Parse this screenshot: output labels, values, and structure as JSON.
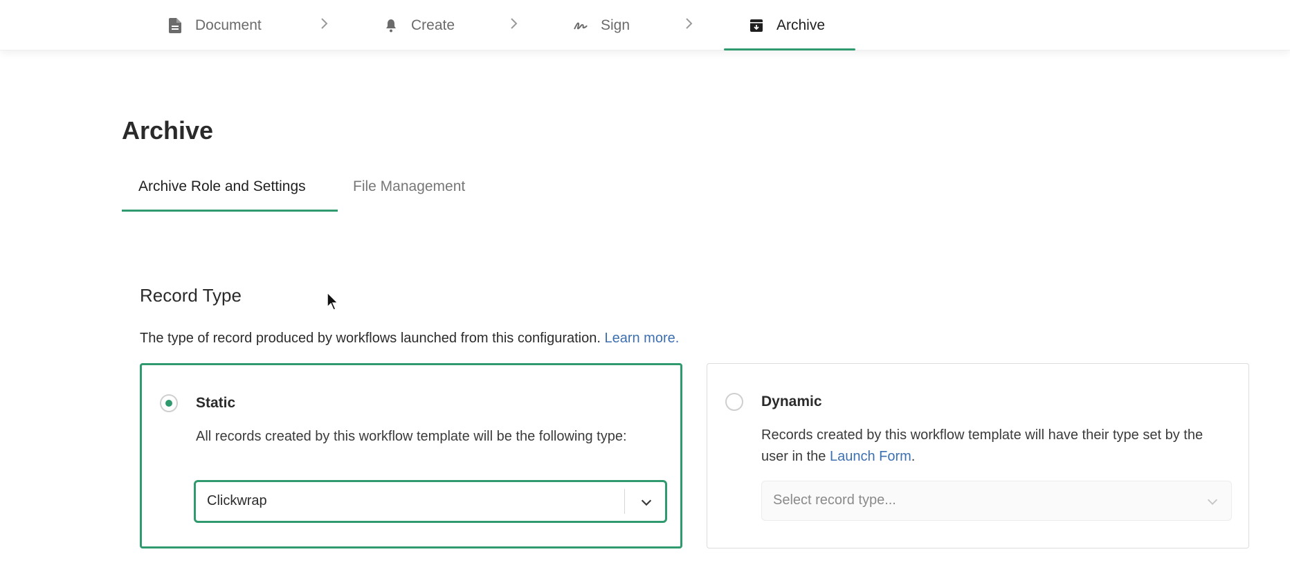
{
  "stepnav": {
    "steps": [
      {
        "label": "Document",
        "icon": "document-icon",
        "active": false
      },
      {
        "label": "Create",
        "icon": "bell-icon",
        "active": false
      },
      {
        "label": "Sign",
        "icon": "signature-icon",
        "active": false
      },
      {
        "label": "Archive",
        "icon": "archive-box-icon",
        "active": true
      }
    ]
  },
  "page": {
    "title": "Archive",
    "tabs": [
      {
        "label": "Archive Role and Settings",
        "active": true
      },
      {
        "label": "File Management",
        "active": false
      }
    ]
  },
  "record_type": {
    "title": "Record Type",
    "description": "The type of record produced by workflows launched from this configuration.",
    "learn_more": "Learn more.",
    "options": [
      {
        "label": "Static",
        "selected": true,
        "description": "All records created by this workflow template will be the following type:",
        "select_value": "Clickwrap"
      },
      {
        "label": "Dynamic",
        "selected": false,
        "description_prefix": "Records created by this workflow template will have their type set by the user in the",
        "description_link": "Launch Form",
        "description_suffix": ".",
        "select_placeholder": "Select record type..."
      }
    ]
  },
  "colors": {
    "accent": "#2e9a6e",
    "link": "#3c6fb0"
  }
}
